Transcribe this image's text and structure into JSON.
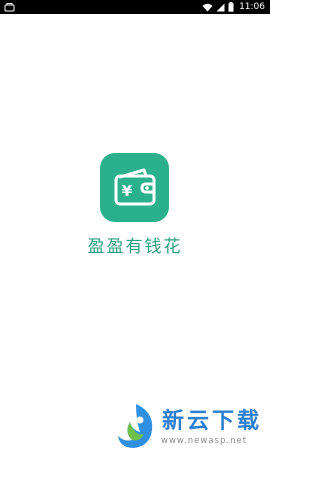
{
  "status_bar": {
    "time": "11:06",
    "icons": [
      "notification-icon",
      "wifi-icon",
      "signal-icon",
      "battery-icon"
    ]
  },
  "splash": {
    "app_name": "盈盈有钱花",
    "icon": "wallet-yen-icon",
    "icon_glyph": "¥",
    "brand_color": "#2bb08e"
  },
  "watermark": {
    "title": "新云下载",
    "url": "www.newasp.net",
    "brand_color": "#2d7fd0"
  }
}
